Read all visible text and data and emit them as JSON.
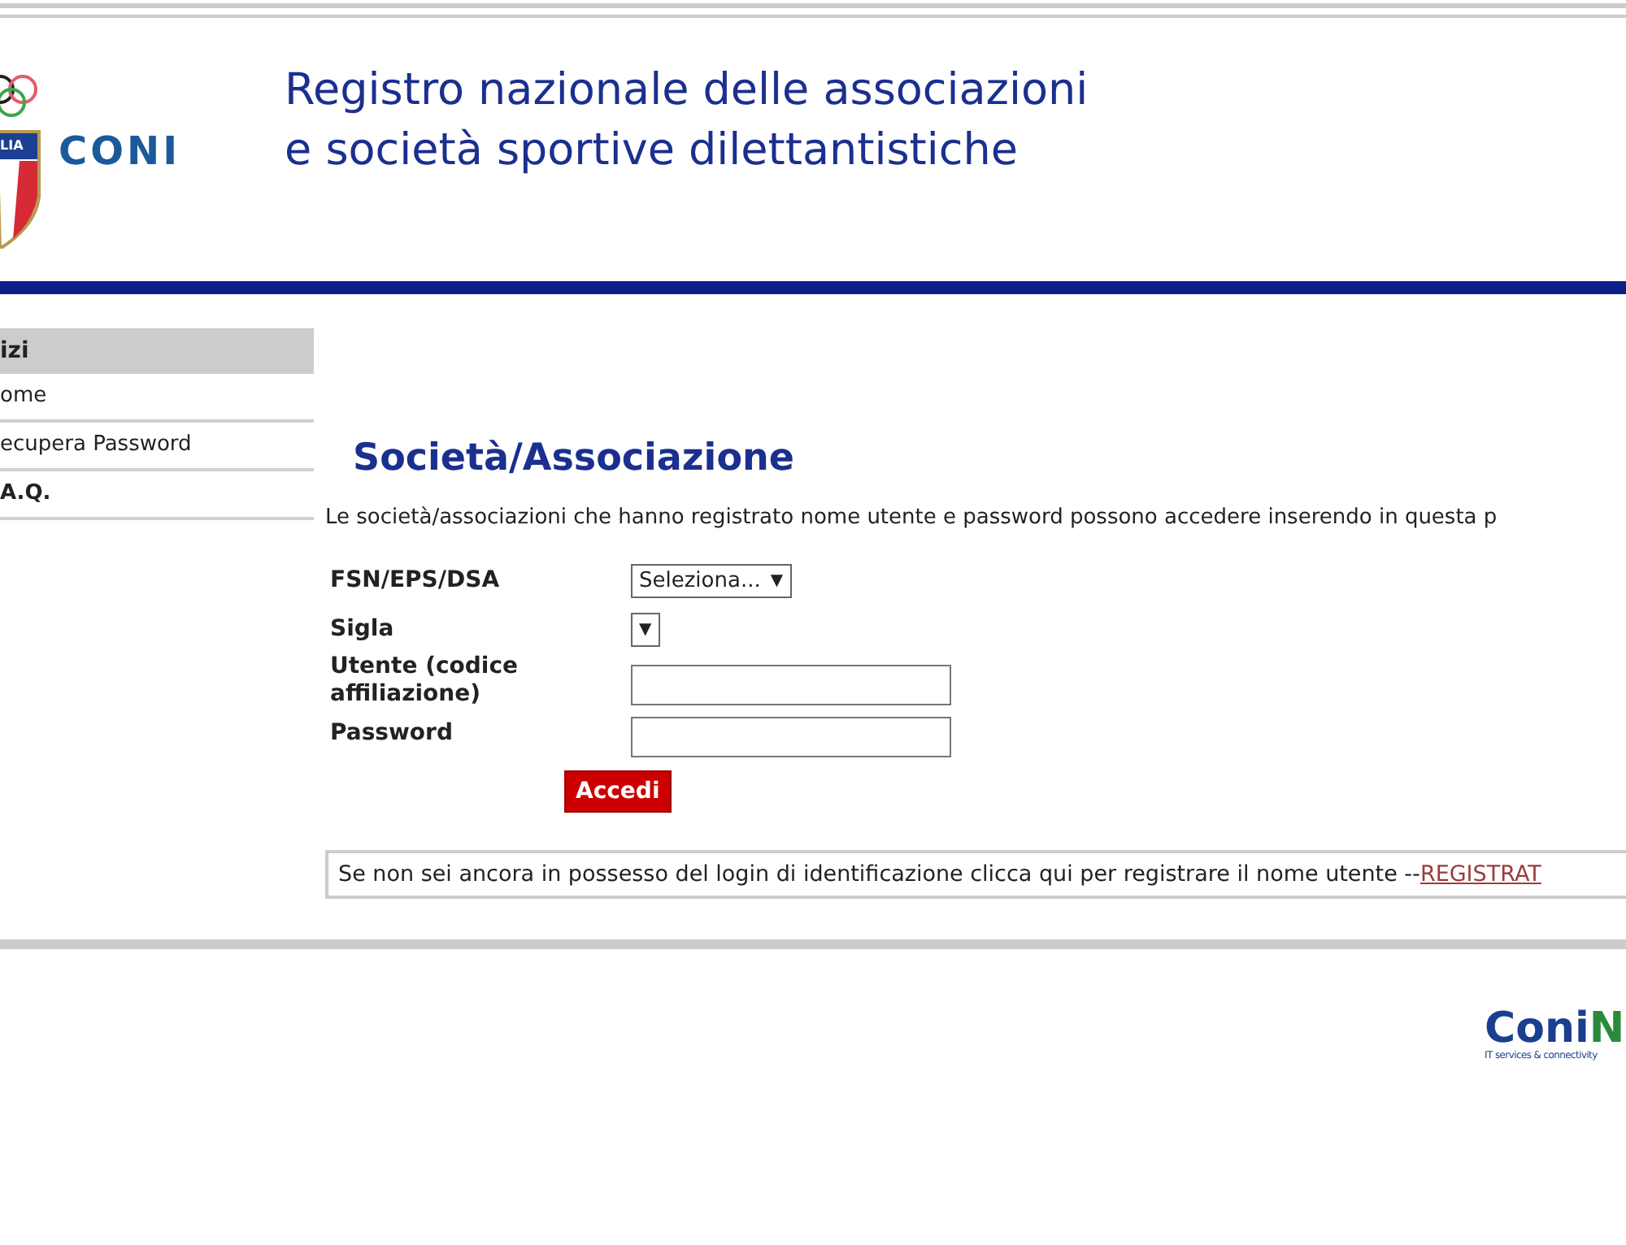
{
  "header": {
    "logo_text": "CONI",
    "shield_text": "LIA",
    "title_lines": [
      "Registro nazionale delle associazioni",
      "e società sportive dilettantistiche"
    ]
  },
  "sidebar": {
    "heading": "izi",
    "items": [
      {
        "label": "ome",
        "bold": false
      },
      {
        "label": "ecupera Password",
        "bold": false
      },
      {
        "label": "A.Q.",
        "bold": true
      }
    ]
  },
  "main": {
    "title": "Società/Associazione",
    "intro": "Le società/associazioni che hanno registrato nome utente e password possono accedere inserendo in questa p",
    "fields": [
      {
        "label": "FSN/EPS/DSA",
        "kind": "select",
        "value": "Seleziona...",
        "arrow": "▼"
      },
      {
        "label": "Sigla",
        "kind": "select",
        "arrow": "▼"
      },
      {
        "label": "Utente (codice affiliazione)",
        "kind": "input"
      },
      {
        "label": "Password",
        "kind": "input"
      }
    ],
    "submit": "Accedi",
    "register": {
      "text": "Se non sei ancora in possesso del login di identificazione clicca qui per registrare il nome utente --",
      "link": "REGISTRAT"
    }
  },
  "footer": {
    "brand": "ConiN",
    "tagline": "IT services & connectivity"
  }
}
